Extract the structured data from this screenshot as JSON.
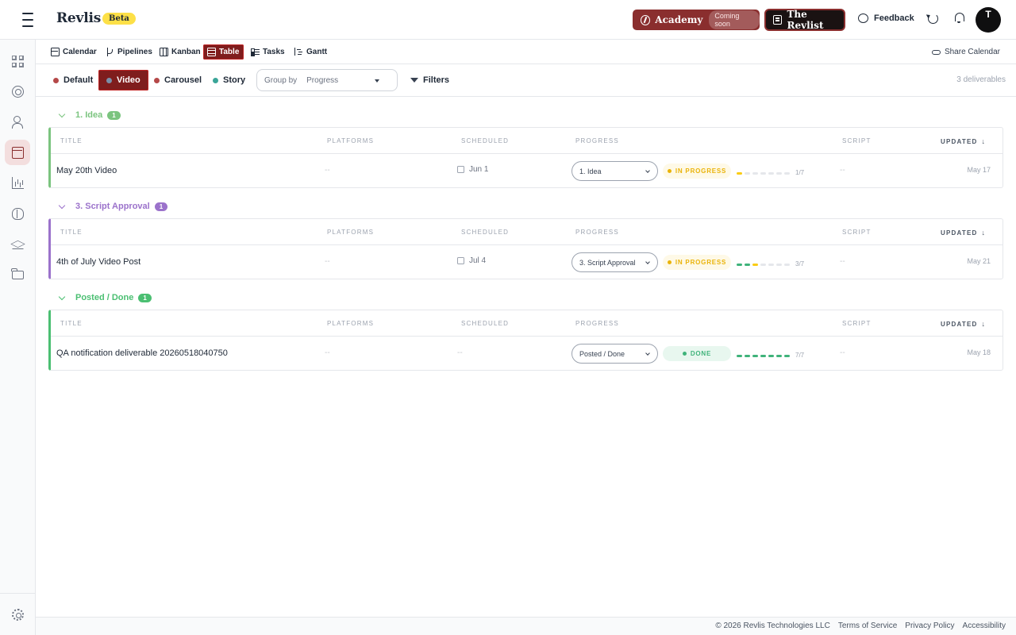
{
  "header": {
    "brand": "Revlis",
    "beta": "Beta",
    "academy": {
      "label": "Academy",
      "badge": "Coming soon"
    },
    "revlist": "The Revlist",
    "feedback": "Feedback",
    "avatar_initial": "T"
  },
  "views": [
    {
      "label": "Calendar",
      "icon": "calendar-icon"
    },
    {
      "label": "Pipelines",
      "icon": "branch-icon"
    },
    {
      "label": "Kanban",
      "icon": "kanban-icon"
    },
    {
      "label": "Table",
      "icon": "table-icon",
      "active": true
    },
    {
      "label": "Tasks",
      "icon": "tasks-icon"
    },
    {
      "label": "Gantt",
      "icon": "gantt-icon"
    }
  ],
  "share": "Share Calendar",
  "content_types": [
    {
      "label": "Default",
      "color": "#b54848"
    },
    {
      "label": "Video",
      "color": "#7a8fa8",
      "active": true
    },
    {
      "label": "Carousel",
      "color": "#b54848"
    },
    {
      "label": "Story",
      "color": "#3aa598"
    }
  ],
  "group_by": {
    "label": "Group by",
    "value": "Progress"
  },
  "filters": "Filters",
  "deliverable_count": "3 deliverables",
  "columns": {
    "title": "TITLE",
    "platforms": "PLATFORMS",
    "scheduled": "SCHEDULED",
    "progress": "PROGRESS",
    "script": "SCRIPT",
    "updated": "UPDATED"
  },
  "groups": [
    {
      "name": "1. Idea",
      "count": "1",
      "color": "#7bc47f",
      "rows": [
        {
          "title": "May 20th Video",
          "platforms": "--",
          "scheduled": "Jun 1",
          "progress": "1. Idea",
          "status": "IN PROGRESS",
          "steps_done": 1,
          "steps_total": 7,
          "steps_label": "1/7",
          "script": "--",
          "updated": "May 17"
        }
      ]
    },
    {
      "name": "3. Script Approval",
      "count": "1",
      "color": "#9b72cb",
      "rows": [
        {
          "title": "4th of July Video Post",
          "platforms": "--",
          "scheduled": "Jul 4",
          "progress": "3. Script Approval",
          "status": "IN PROGRESS",
          "steps_done": 3,
          "steps_total": 7,
          "steps_label": "3/7",
          "script": "--",
          "updated": "May 21"
        }
      ]
    },
    {
      "name": "Posted / Done",
      "count": "1",
      "color": "#4bbf72",
      "rows": [
        {
          "title": "QA notification deliverable 20260518040750",
          "platforms": "--",
          "scheduled": "--",
          "progress": "Posted / Done",
          "status": "DONE",
          "steps_done": 7,
          "steps_total": 7,
          "steps_label": "7/7",
          "script": "--",
          "updated": "May 18"
        }
      ]
    }
  ],
  "footer": {
    "copyright": "© 2026 Revlis Technologies LLC",
    "terms": "Terms of Service",
    "privacy": "Privacy Policy",
    "accessibility": "Accessibility"
  }
}
